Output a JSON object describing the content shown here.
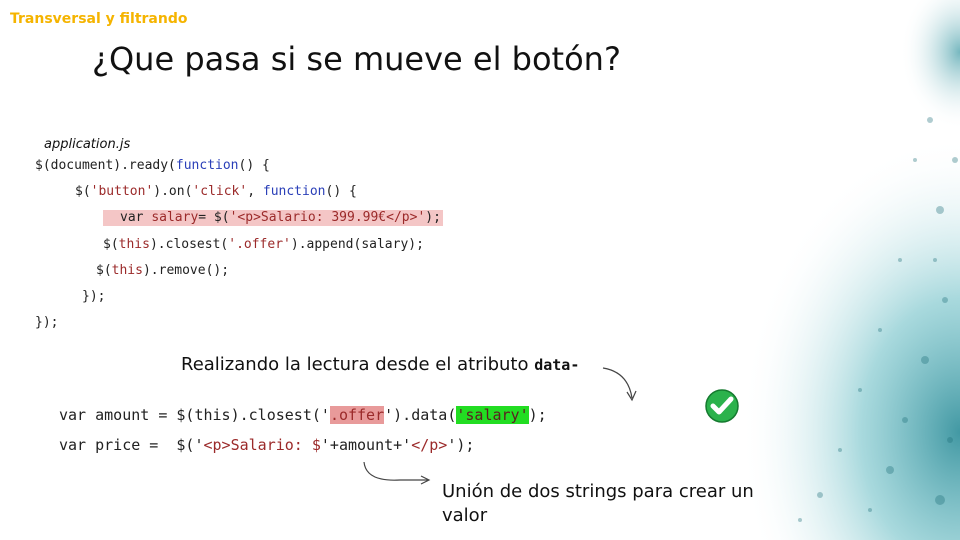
{
  "header": {
    "section_tag": "Transversal y filtrando",
    "title": "¿Que pasa si se mueve el botón?"
  },
  "code_block": {
    "filename": "application.js",
    "line1": {
      "a": "$(document).ready(",
      "b": "function",
      "c": "() {"
    },
    "line2": {
      "a": "$(",
      "b": "'button'",
      "c": ").on(",
      "d": "'click'",
      "e": ", ",
      "f": "function",
      "g": "() {"
    },
    "line3": {
      "a": "var ",
      "b": "salary",
      "c": "= $(",
      "d": "'<p>",
      "e": "Salario: 399.99€",
      "f": "</p>'",
      "g": ");"
    },
    "line4": {
      "a": "$(",
      "b": "this",
      "c": ").closest(",
      "d": "'.offer'",
      "e": ").append(salary);"
    },
    "line5": {
      "a": "$(",
      "b": "this",
      "c": ").remove();"
    },
    "line6": "});",
    "line7": "});"
  },
  "annotation_data": {
    "text": "Realizando la lectura desde el atributo ",
    "mono": "data-"
  },
  "code_bottom": {
    "line1": {
      "a": "var amount = $(this).closest('",
      "b": ".offer",
      "c": "').data(",
      "d": "'salary'",
      "e": ");"
    },
    "line2": {
      "a": "var price =  $('",
      "b": "<p>",
      "c": "Salario: $",
      "d": "'+amount+'",
      "e": "</p>",
      "f": "');"
    }
  },
  "annotation_union": "Unión de dos strings para crear un valor",
  "colors": {
    "section_tag": "#f5b400",
    "keyword": "#2a3fb8",
    "string": "#9b2a2a",
    "highlight_pink": "#f4c6c6",
    "highlight_green": "#22dd22",
    "check": "#2bb24c"
  },
  "icons": {
    "check": "check-circle-icon"
  }
}
